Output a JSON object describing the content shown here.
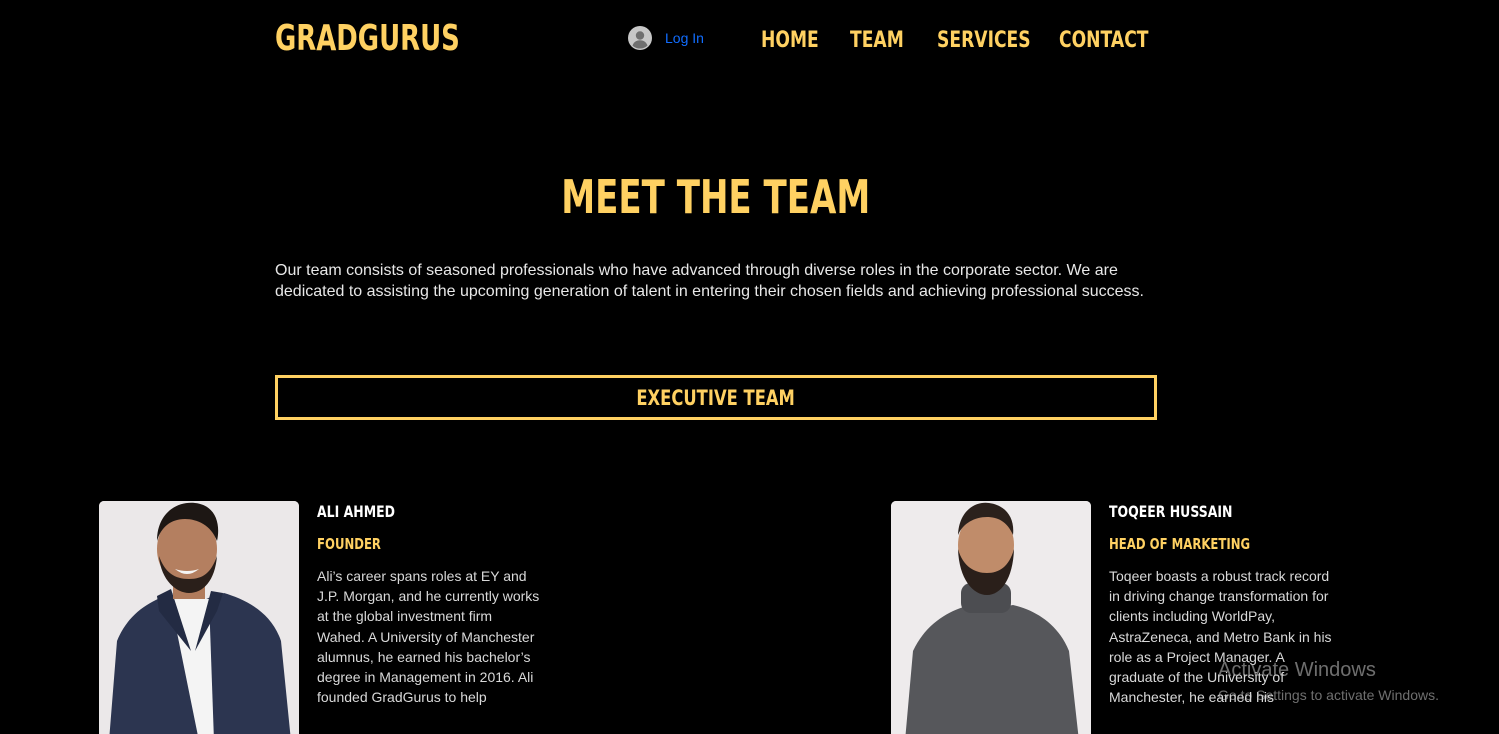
{
  "header": {
    "logo": "GRADGURUS",
    "login_label": "Log In",
    "nav": [
      "HOME",
      "TEAM",
      "SERVICES",
      "CONTACT"
    ]
  },
  "main": {
    "title": "MEET THE TEAM",
    "intro": "Our team consists of seasoned professionals who have advanced through diverse roles in the corporate sector. We are dedicated to assisting the upcoming generation of talent in entering their chosen fields and achieving professional success.",
    "section_label": "EXECUTIVE TEAM"
  },
  "team": [
    {
      "name": "ALI AHMED",
      "role": "FOUNDER",
      "bio": "Ali’s career spans roles at EY and J.P. Morgan, and he currently works at the global investment firm Wahed. A University of Manchester alumnus, he earned his bachelor’s degree in Management in 2016. Ali founded GradGurus to help"
    },
    {
      "name": "TOQEER HUSSAIN",
      "role": "HEAD OF MARKETING",
      "bio": "Toqeer boasts a robust track record in driving change transformation for clients including WorldPay, AstraZeneca, and Metro Bank in his role as a Project Manager. A graduate of the University of Manchester, he earned his"
    }
  ],
  "os_watermark": {
    "line1": "Activate Windows",
    "line2": "Go to Settings to activate Windows."
  },
  "colors": {
    "background": "#000000",
    "accent": "#ffd162",
    "link": "#116dff"
  }
}
